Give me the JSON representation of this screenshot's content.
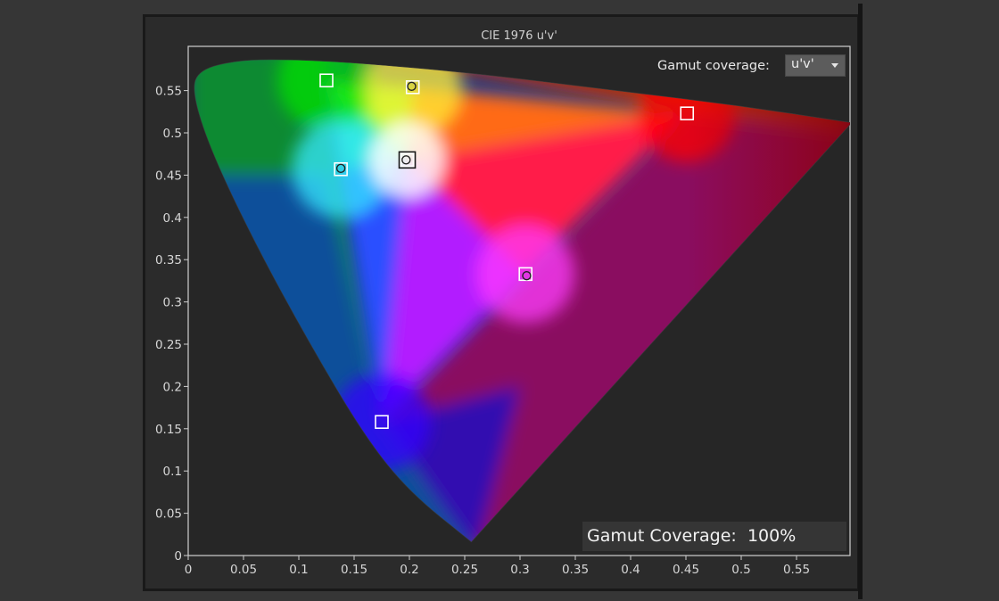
{
  "chart_data": {
    "type": "scatter",
    "title": "CIE 1976 u'v'",
    "xlabel": "",
    "ylabel": "",
    "xlim": [
      0,
      0.6
    ],
    "ylim": [
      0,
      0.6
    ],
    "x_ticks": [
      "0",
      "0.05",
      "0.1",
      "0.15",
      "0.2",
      "0.25",
      "0.3",
      "0.35",
      "0.4",
      "0.45",
      "0.5",
      "0.55"
    ],
    "y_ticks": [
      "0",
      "0.05",
      "0.1",
      "0.15",
      "0.2",
      "0.25",
      "0.3",
      "0.35",
      "0.4",
      "0.45",
      "0.5",
      "0.55"
    ],
    "grid": false,
    "gamut_target": [
      {
        "name": "red",
        "u": 0.451,
        "v": 0.523
      },
      {
        "name": "green",
        "u": 0.125,
        "v": 0.562
      },
      {
        "name": "blue",
        "u": 0.175,
        "v": 0.158
      },
      {
        "name": "white",
        "u": 0.198,
        "v": 0.468
      },
      {
        "name": "yellow",
        "u": 0.203,
        "v": 0.554
      },
      {
        "name": "cyan",
        "u": 0.138,
        "v": 0.457
      },
      {
        "name": "magenta",
        "u": 0.305,
        "v": 0.333
      }
    ],
    "measured": [
      {
        "name": "yellow",
        "u": 0.202,
        "v": 0.555
      },
      {
        "name": "cyan",
        "u": 0.138,
        "v": 0.458
      },
      {
        "name": "magenta",
        "u": 0.306,
        "v": 0.331
      },
      {
        "name": "white",
        "u": 0.197,
        "v": 0.468
      }
    ],
    "spectral_locus": [
      [
        0.256,
        0.016
      ],
      [
        0.2,
        0.075
      ],
      [
        0.16,
        0.14
      ],
      [
        0.11,
        0.25
      ],
      [
        0.06,
        0.37
      ],
      [
        0.02,
        0.48
      ],
      [
        0.003,
        0.55
      ],
      [
        0.01,
        0.575
      ],
      [
        0.045,
        0.586
      ],
      [
        0.085,
        0.587
      ],
      [
        0.14,
        0.584
      ],
      [
        0.25,
        0.572
      ],
      [
        0.4,
        0.548
      ],
      [
        0.5,
        0.532
      ],
      [
        0.6,
        0.512
      ]
    ]
  },
  "gamut_control": {
    "label": "Gamut coverage:",
    "selected": "u'v'"
  },
  "coverage": {
    "label": "Gamut Coverage:",
    "value": "100%"
  },
  "colors": {
    "background": "#363636",
    "panel": "#2b2b2b",
    "plot_background": "#262626",
    "red": "#ff1a1a",
    "green": "#00cc00",
    "blue": "#2a00ff",
    "white": "#ffffff"
  }
}
